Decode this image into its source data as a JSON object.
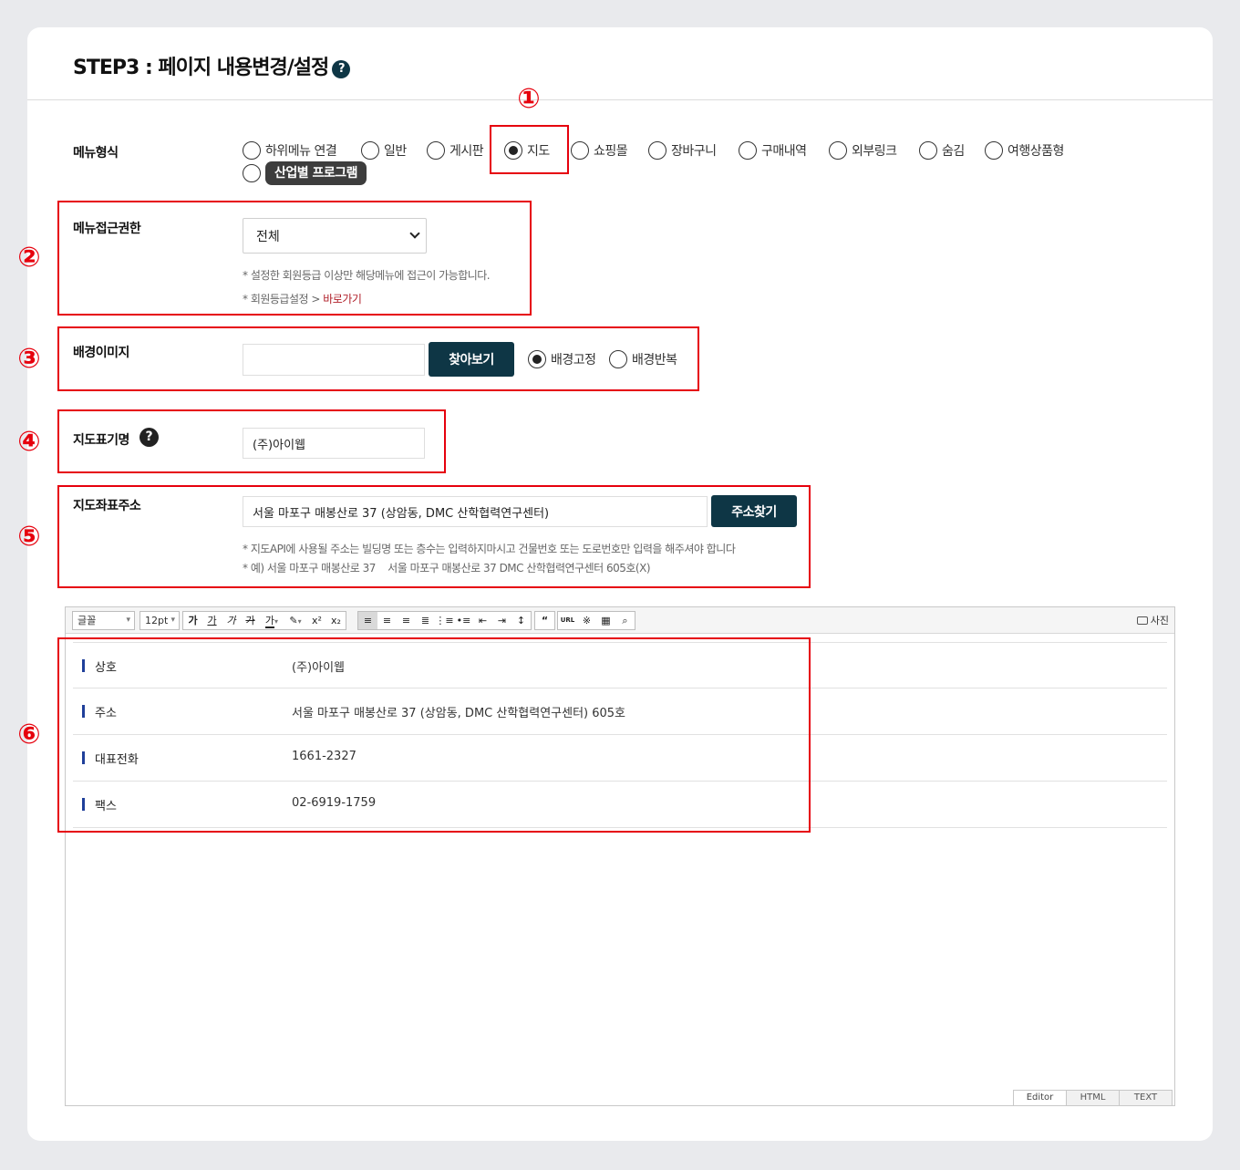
{
  "header": {
    "title": "STEP3 : 페이지 내용변경/설정",
    "help": "?"
  },
  "menu_type": {
    "label": "메뉴형식",
    "options": [
      "하위메뉴 연결",
      "일반",
      "게시판",
      "지도",
      "쇼핑몰",
      "장바구니",
      "구매내역",
      "외부링크",
      "숨김",
      "여행상품형"
    ],
    "extra_option": "산업별 프로그램",
    "selected": "지도"
  },
  "access": {
    "label": "메뉴접근권한",
    "value": "전체",
    "note1": "* 설정한 회원등급 이상만 해당메뉴에 접근이 가능합니다.",
    "note2_prefix": "* 회원등급설정 > ",
    "note2_link": "바로가기"
  },
  "background": {
    "label": "배경이미지",
    "input_value": "",
    "browse_label": "찾아보기",
    "options": [
      "배경고정",
      "배경반복"
    ],
    "selected": "배경고정"
  },
  "map_name": {
    "label": "지도표기명",
    "help": "?",
    "value": "(주)아이웹"
  },
  "map_address": {
    "label": "지도좌표주소",
    "value": "서울 마포구 매봉산로 37 (상암동, DMC 산학협력연구센터)",
    "button": "주소찾기",
    "note1": "* 지도API에 사용될 주소는 빌딩명 또는 층수는 입력하지마시고 건물번호 또는 도로번호만 입력을 해주셔야 합니다",
    "note2": "* 예) 서울 마포구 매봉산로 37    서울 마포구 매봉산로 37 DMC 산학협력연구센터 605호(X)"
  },
  "markers": [
    "①",
    "②",
    "③",
    "④",
    "⑤",
    "⑥"
  ],
  "editor": {
    "font_select": "글꼴",
    "size_select": "12pt",
    "text_buttons": [
      "가",
      "가",
      "가",
      "가",
      "가"
    ],
    "photo": "사진",
    "rows": [
      {
        "key": "상호",
        "value": "(주)아이웹"
      },
      {
        "key": "주소",
        "value": "서울 마포구 매봉산로 37 (상암동, DMC 산학협력연구센터) 605호"
      },
      {
        "key": "대표전화",
        "value": "1661-2327"
      },
      {
        "key": "팩스",
        "value": "02-6919-1759"
      }
    ],
    "tabs": [
      "Editor",
      "HTML",
      "TEXT"
    ]
  }
}
